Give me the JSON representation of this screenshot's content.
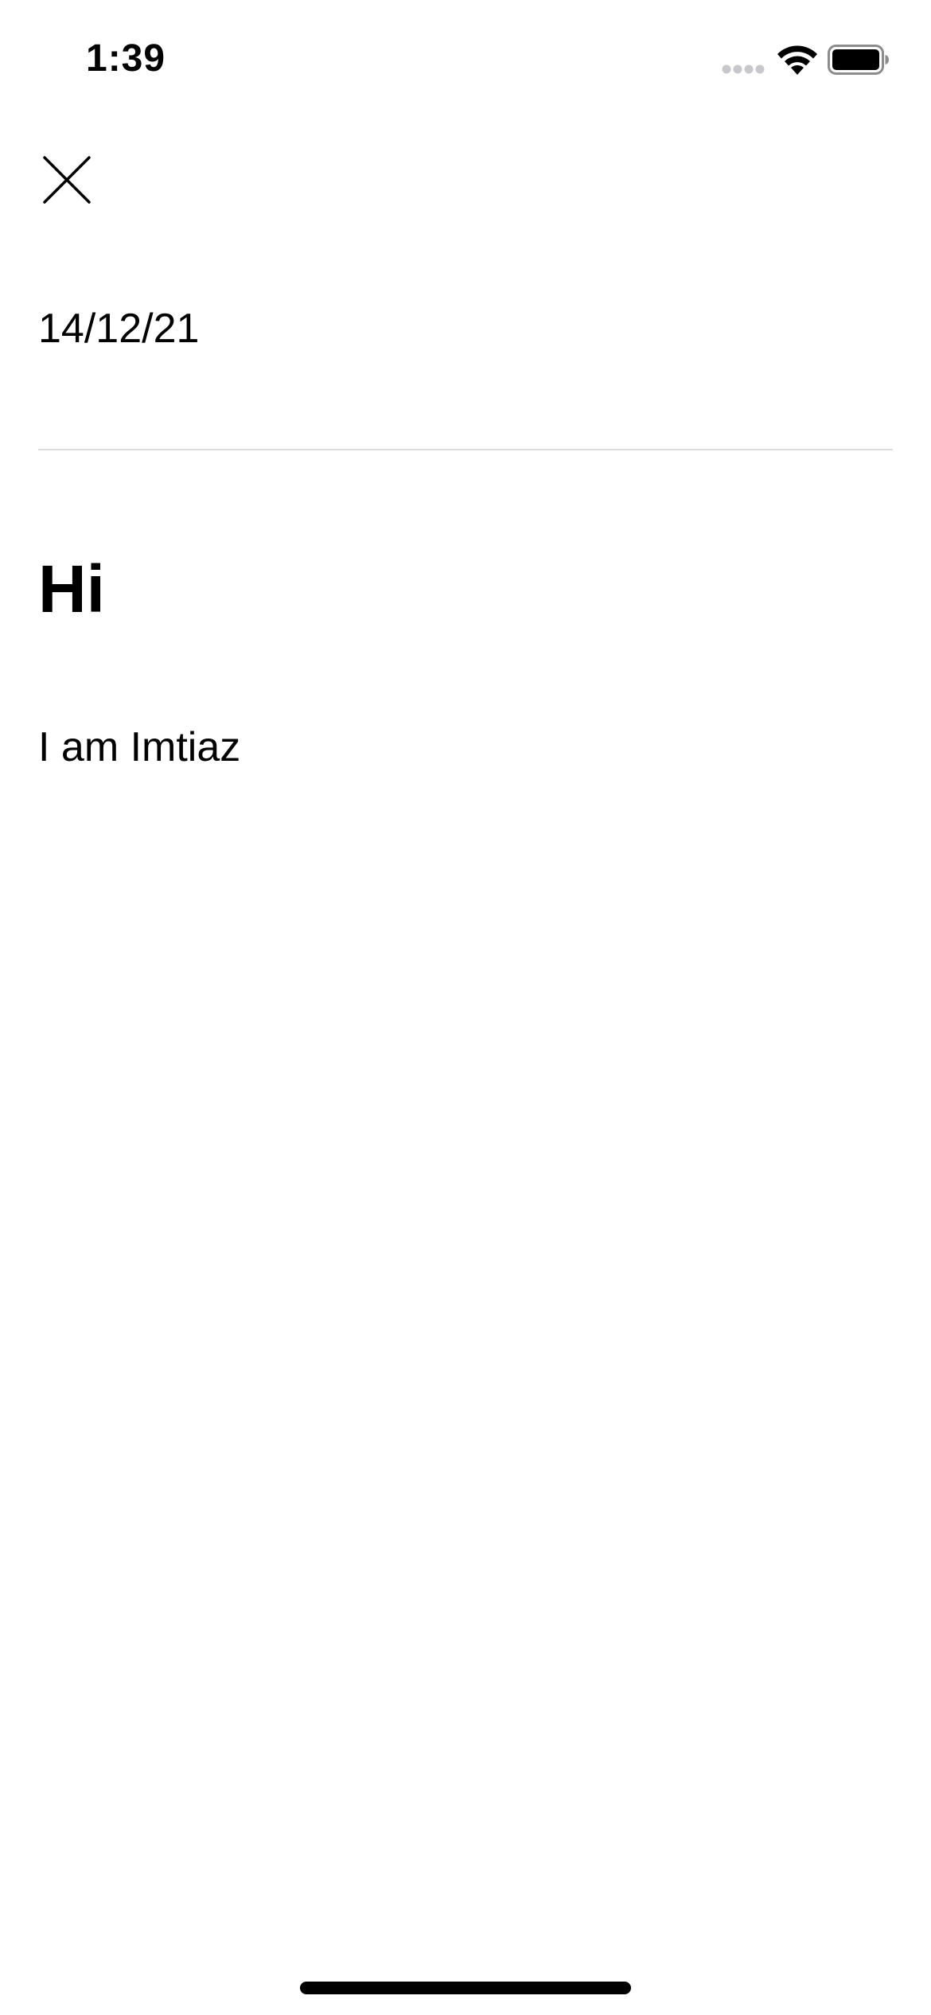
{
  "status_bar": {
    "time": "1:39",
    "signal_icon": "cellular-signal-icon",
    "wifi_icon": "wifi-icon",
    "battery_icon": "battery-icon"
  },
  "toolbar": {
    "close_icon": "close-icon"
  },
  "note": {
    "date": "14/12/21",
    "title": "Hi",
    "body": "I am Imtiaz"
  },
  "colors": {
    "background": "#ffffff",
    "text": "#000000",
    "divider": "#dcdcdc",
    "signal_inactive": "#c7c7cc"
  }
}
